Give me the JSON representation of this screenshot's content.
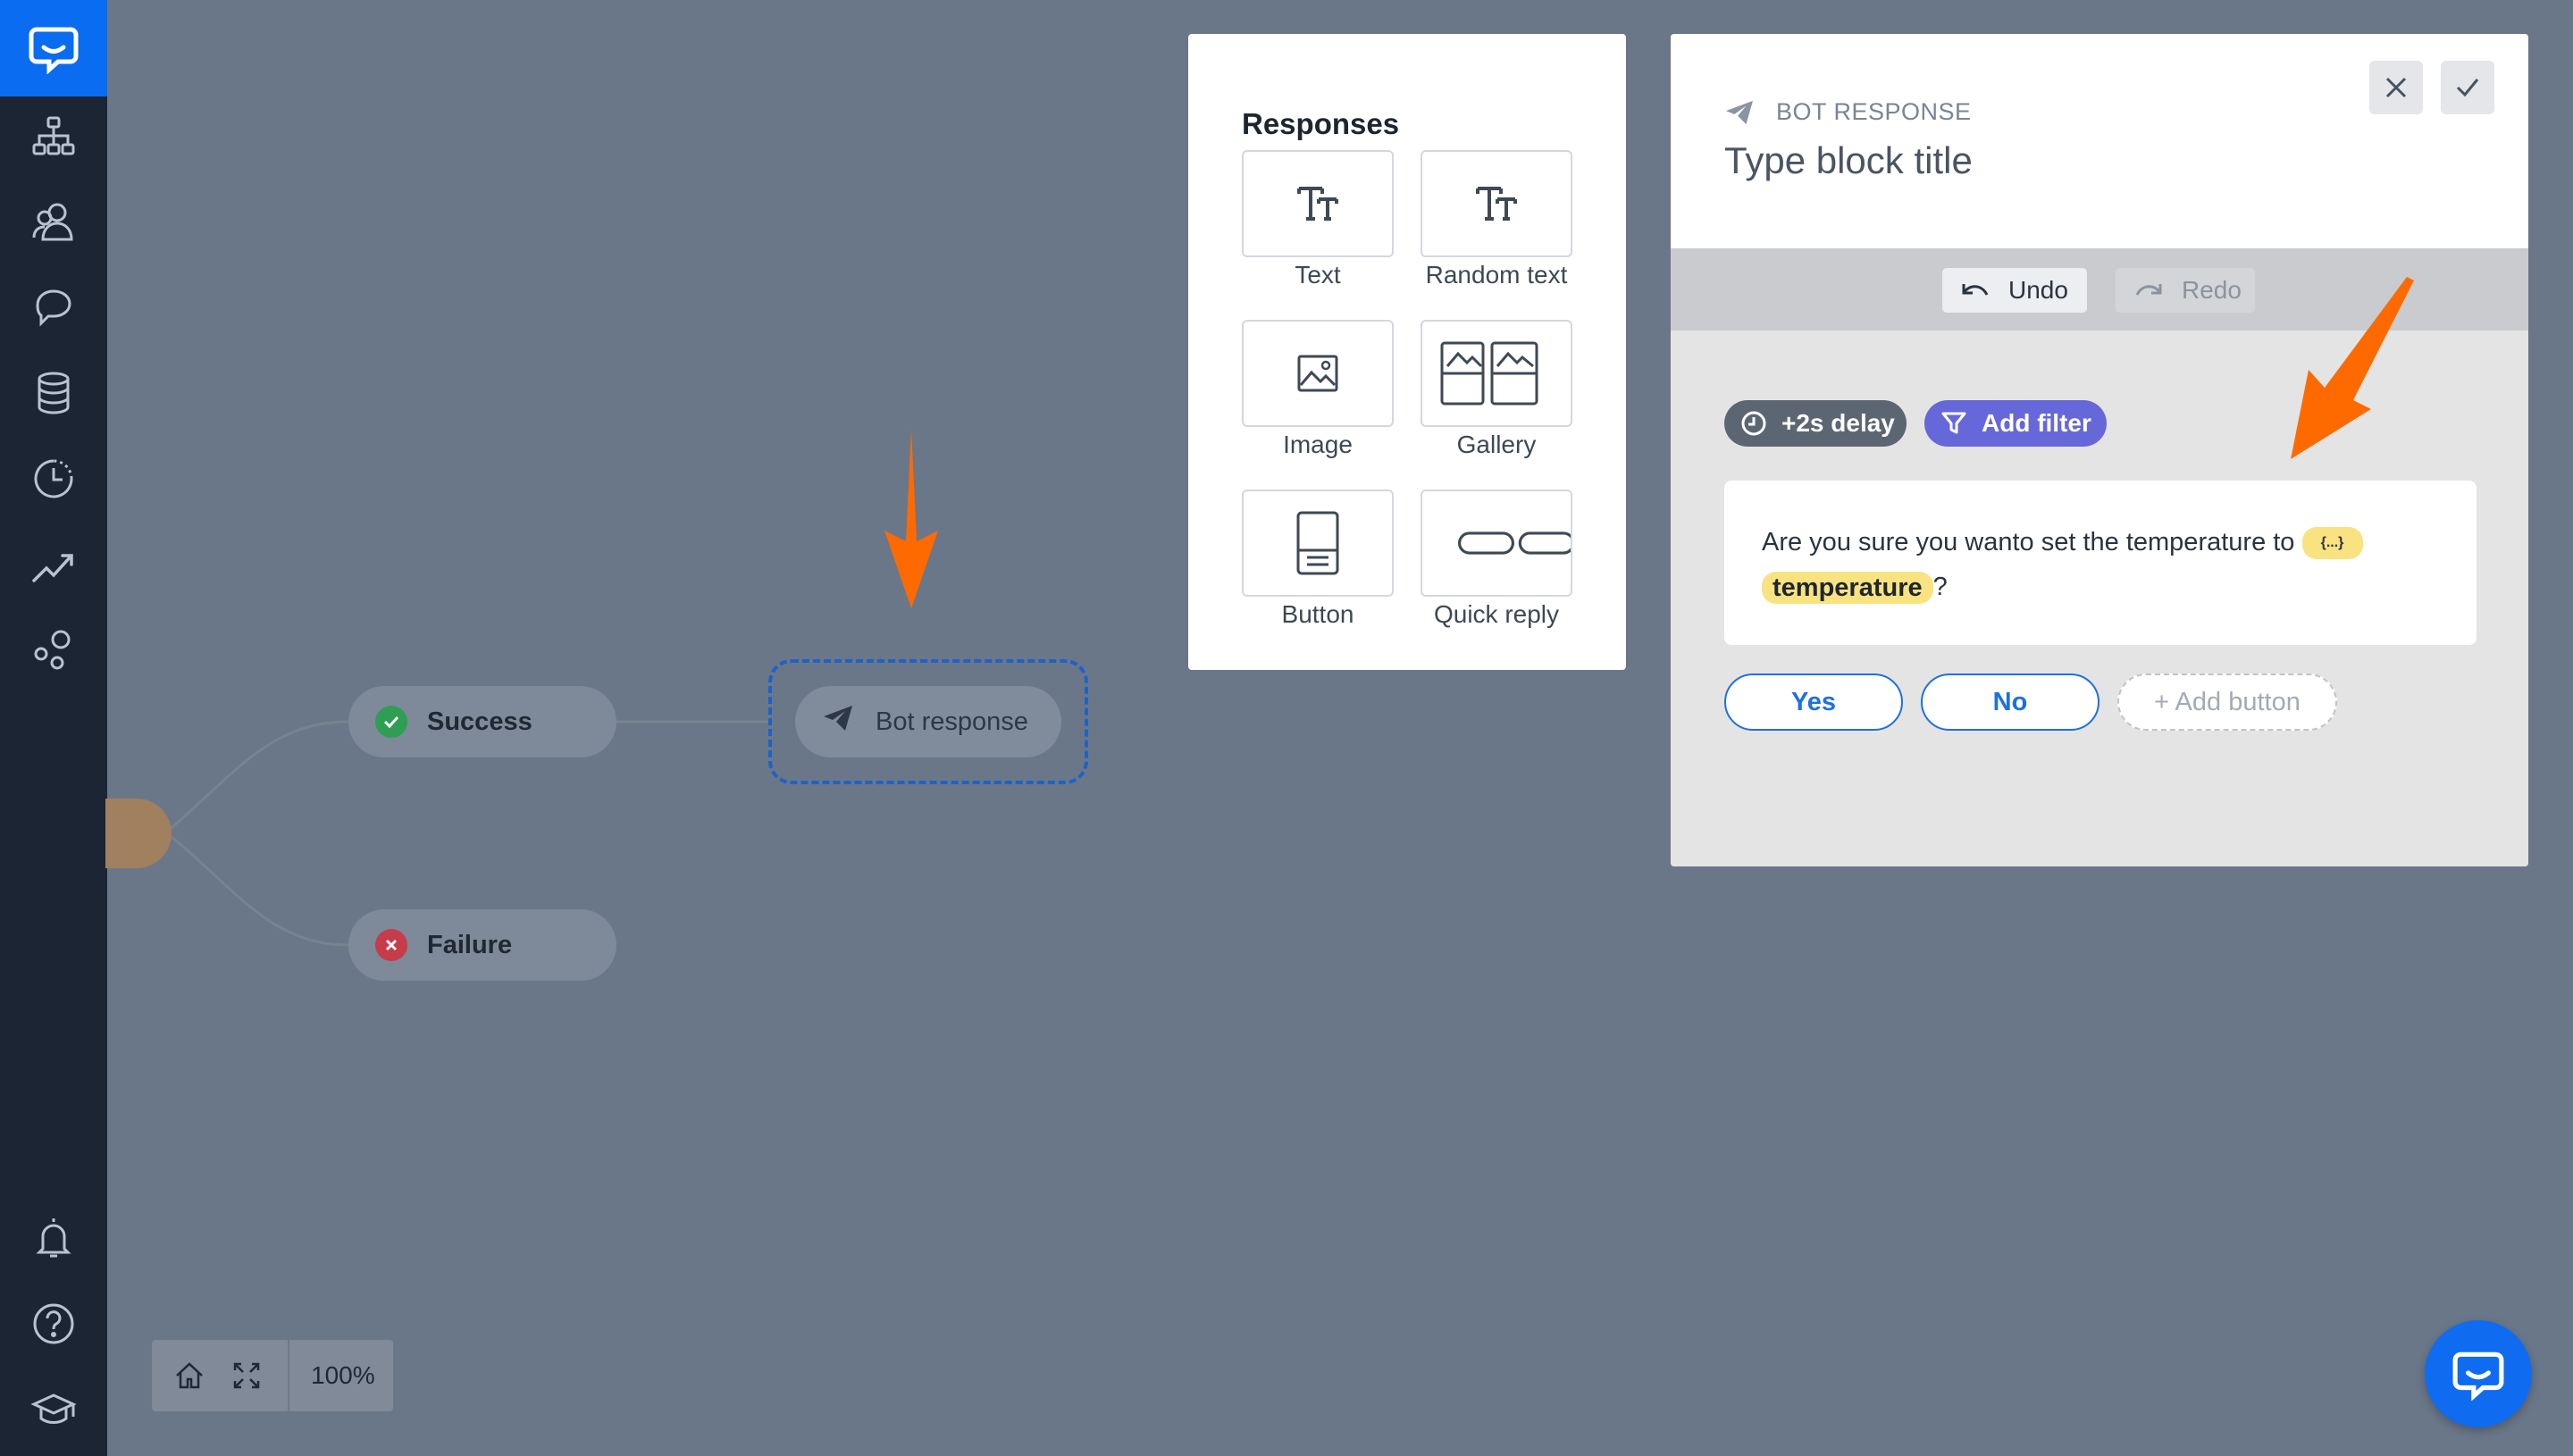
{
  "canvas": {
    "nodes": {
      "success_label": "Success",
      "failure_label": "Failure",
      "bot_label": "Bot response"
    },
    "zoom_level": "100%"
  },
  "sidebar": {
    "items": [
      {
        "icon": "chatbot-logo-icon"
      },
      {
        "icon": "stories-icon"
      },
      {
        "icon": "users-icon"
      },
      {
        "icon": "intents-icon"
      },
      {
        "icon": "database-icon"
      },
      {
        "icon": "history-icon"
      },
      {
        "icon": "analytics-icon"
      },
      {
        "icon": "integrations-icon"
      },
      {
        "icon": "notifications-icon"
      },
      {
        "icon": "help-icon"
      },
      {
        "icon": "academy-icon"
      }
    ]
  },
  "responses_panel": {
    "title": "Responses",
    "tiles": [
      {
        "label": "Text",
        "icon": "text-icon"
      },
      {
        "label": "Random text",
        "icon": "random-text-icon"
      },
      {
        "label": "Image",
        "icon": "image-icon"
      },
      {
        "label": "Gallery",
        "icon": "gallery-icon"
      },
      {
        "label": "Button",
        "icon": "button-icon"
      },
      {
        "label": "Quick reply",
        "icon": "quick-reply-icon"
      }
    ]
  },
  "editor": {
    "kicker": "BOT RESPONSE",
    "title_placeholder": "Type block title",
    "undo_label": "Undo",
    "redo_label": "Redo",
    "delay_label": "+2s delay",
    "filter_label": "Add filter",
    "message_text": "Are you sure you wanto set the temperature to",
    "variable_chip_small": "{...}",
    "variable_name": "temperature",
    "message_suffix": "?",
    "quick_replies": [
      "Yes",
      "No"
    ],
    "add_button_label": "+ Add button"
  },
  "colors": {
    "accent": "#0f6cf0",
    "annotation_arrow": "#ff6a00",
    "filter_pill": "#6668d9",
    "variable_chip": "#f9e380"
  }
}
